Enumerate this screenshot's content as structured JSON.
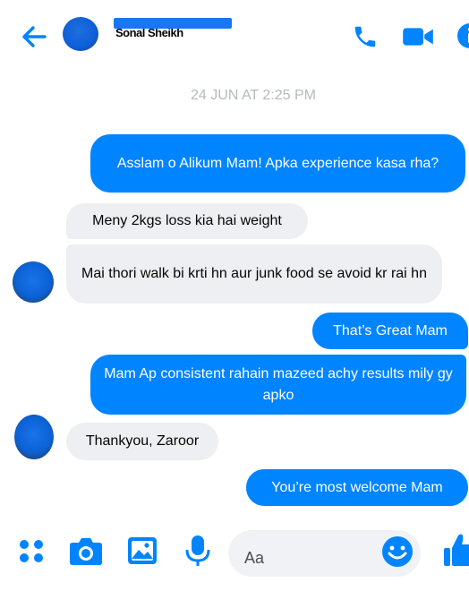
{
  "header": {
    "contact_name": "Sonal Sheikh"
  },
  "timestamp": "24 JUN AT 2:25 PM",
  "messages": [
    {
      "side": "out",
      "text": "Asslam o Alikum Mam! Apka experience kasa rha?"
    },
    {
      "side": "in",
      "text": "Meny 2kgs loss kia hai weight"
    },
    {
      "side": "in",
      "text": "Mai thori walk bi krti hn aur junk food se avoid kr rai hn"
    },
    {
      "side": "out",
      "text": "That’s Great Mam"
    },
    {
      "side": "out",
      "text": "Mam Ap consistent rahain mazeed achy results mily gy apko"
    },
    {
      "side": "in",
      "text": "Thankyou, Zaroor"
    },
    {
      "side": "out",
      "text": "You’re most welcome Mam"
    }
  ],
  "composer": {
    "placeholder": "Aa"
  },
  "colors": {
    "accent": "#0084ff",
    "incoming_bubble": "#eeeff2",
    "timestamp": "#b6b9be"
  }
}
